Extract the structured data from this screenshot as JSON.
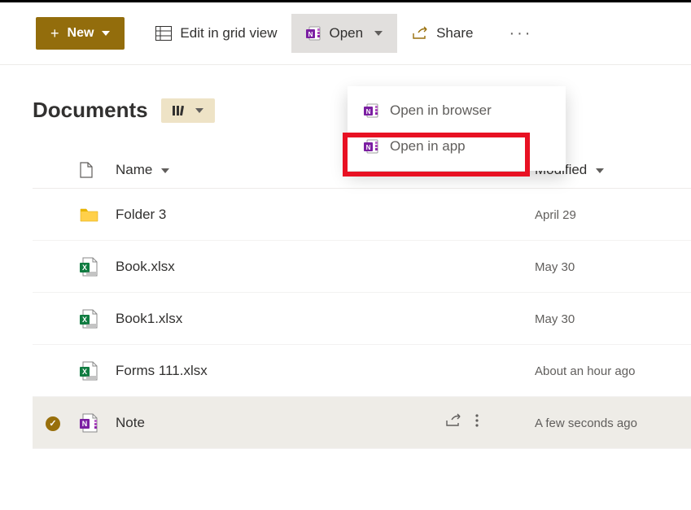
{
  "toolbar": {
    "new_label": "New",
    "edit_grid_label": "Edit in grid view",
    "open_label": "Open",
    "share_label": "Share"
  },
  "dropdown": {
    "open_browser": "Open in browser",
    "open_app": "Open in app"
  },
  "library": {
    "title": "Documents"
  },
  "columns": {
    "name": "Name",
    "modified": "Modified"
  },
  "rows": [
    {
      "type": "folder",
      "name": "Folder 3",
      "modified": "April 29",
      "selected": false
    },
    {
      "type": "xlsx",
      "name": "Book.xlsx",
      "modified": "May 30",
      "selected": false
    },
    {
      "type": "xlsx",
      "name": "Book1.xlsx",
      "modified": "May 30",
      "selected": false
    },
    {
      "type": "xlsx",
      "name": "Forms 111.xlsx",
      "modified": "About an hour ago",
      "selected": false
    },
    {
      "type": "onenote",
      "name": "Note",
      "modified": "A few seconds ago",
      "selected": true
    }
  ]
}
